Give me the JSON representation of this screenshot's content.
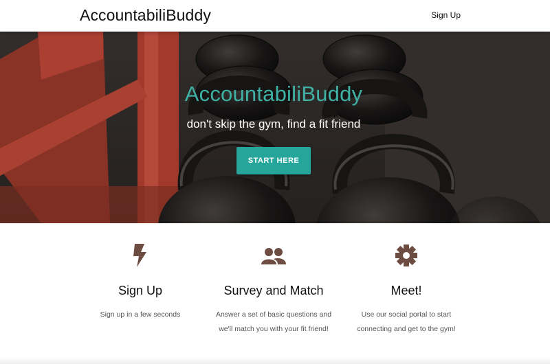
{
  "navbar": {
    "brand": "AccountabiliBuddy",
    "signup_link": "Sign Up"
  },
  "hero": {
    "title": "AccountabiliBuddy",
    "subtitle": "don't skip the gym, find a fit friend",
    "cta_label": "START HERE",
    "image": "kettlebells-photo"
  },
  "features": [
    {
      "icon": "lightning-bolt-icon",
      "title": "Sign Up",
      "text": "Sign up in a few seconds"
    },
    {
      "icon": "people-icon",
      "title": "Survey and Match",
      "text": "Answer a set of basic questions and we'll match you with your fit friend!"
    },
    {
      "icon": "gear-icon",
      "title": "Meet!",
      "text": "Use our social portal to start connecting and get to the gym!"
    }
  ],
  "colors": {
    "accent": "#26a69a",
    "hero_title": "#3fb1a4",
    "icon_brown": "#6d4c41"
  }
}
